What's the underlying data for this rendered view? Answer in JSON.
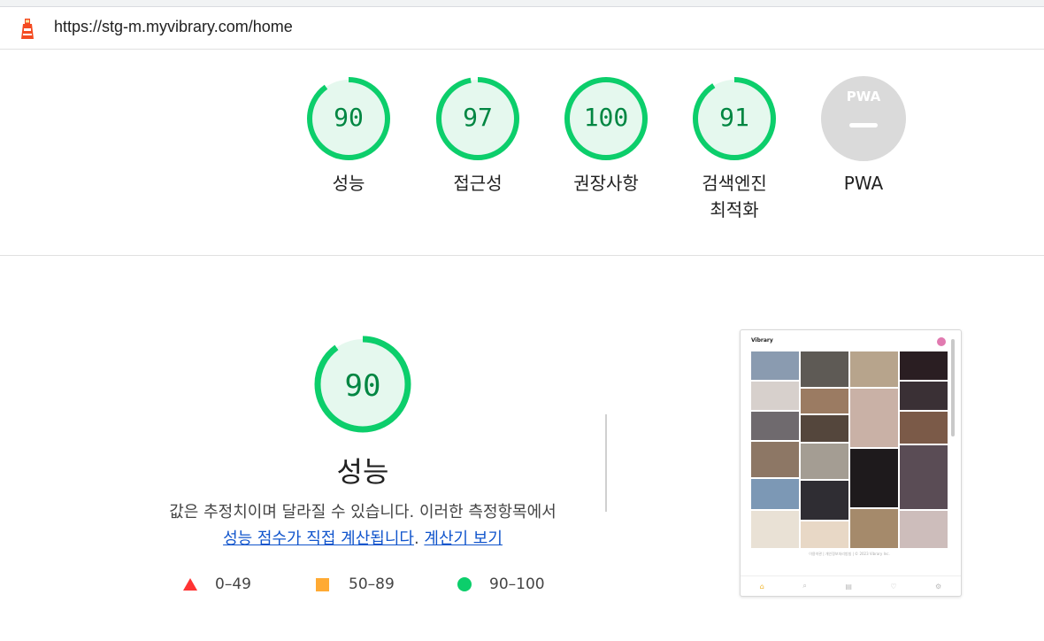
{
  "url": "https://stg-m.myvibrary.com/home",
  "gauges": [
    {
      "score": "90",
      "label": "성능",
      "progress": 0.9
    },
    {
      "score": "97",
      "label": "접근성",
      "progress": 0.97
    },
    {
      "score": "100",
      "label": "권장사항",
      "progress": 1.0
    },
    {
      "score": "91",
      "label": "검색엔진 최적화",
      "progress": 0.91
    },
    {
      "score": "",
      "label": "PWA",
      "progress": 0
    }
  ],
  "pwa_badge": "PWA",
  "performance": {
    "score": "90",
    "progress": 0.9,
    "title": "성능",
    "desc_line1": "값은 추정치이며 달라질 수 있습니다. 이러한 측정항목에서",
    "link1": "성능 점수가 직접 계산됩니다",
    "sep": ". ",
    "link2": "계산기 보기"
  },
  "legend": [
    {
      "range": "0–49",
      "color": "#ff3333",
      "shape": "triangle"
    },
    {
      "range": "50–89",
      "color": "#ffaa33",
      "shape": "square"
    },
    {
      "range": "90–100",
      "color": "#0cce6b",
      "shape": "circle"
    }
  ],
  "screenshot": {
    "app_logo": "Vibrary",
    "footer": "이용약관 | 개인정보처리방침 | © 2023 Vibrary Inc.",
    "nav_icons": [
      "⌂",
      "⌕",
      "▤",
      "♡",
      "⚙"
    ]
  },
  "colors": {
    "pass": "#0cce6b",
    "pass_fill": "#e5f8ee",
    "pass_text": "#018642",
    "pwa_gray": "#dadada"
  }
}
